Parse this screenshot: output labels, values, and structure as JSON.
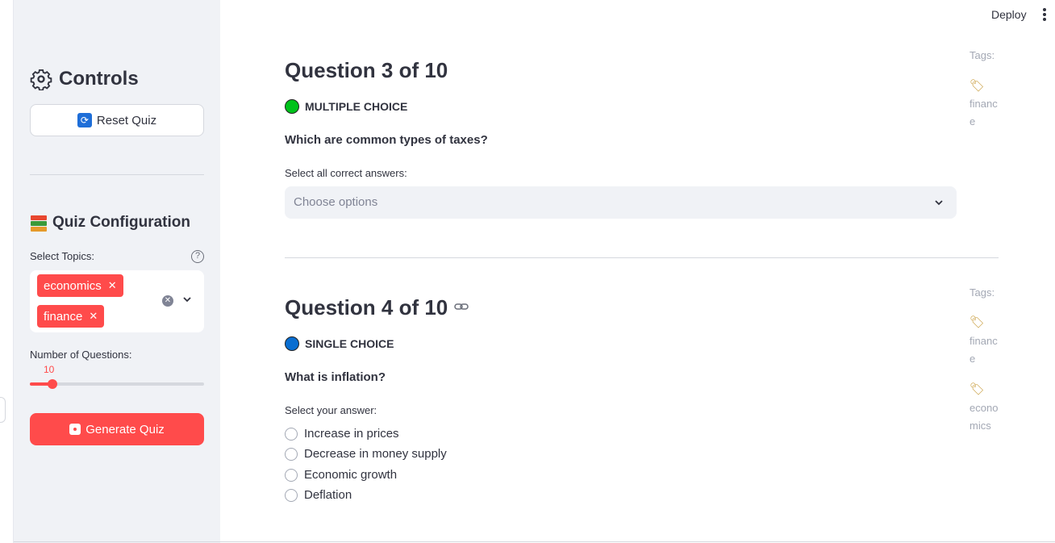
{
  "sidebar": {
    "title": "Controls",
    "reset_button": "Reset Quiz",
    "config_title": "Quiz Configuration",
    "topics_label": "Select Topics:",
    "help_symbol": "?",
    "topics_selected": [
      "economics",
      "finance"
    ],
    "num_questions_label": "Number of Questions:",
    "num_questions_value": "10",
    "num_questions_min": 5,
    "num_questions_max": 50,
    "generate_button": "Generate Quiz"
  },
  "header": {
    "deploy_label": "Deploy"
  },
  "questions": [
    {
      "title": "Question 3 of 10",
      "type_label": "MULTIPLE CHOICE",
      "type_color": "#00c21b",
      "text": "Which are common types of taxes?",
      "instruction": "Select all correct answers:",
      "placeholder": "Choose options",
      "tags_label": "Tags:",
      "tags": [
        "finance"
      ]
    },
    {
      "title": "Question 4 of 10",
      "type_label": "SINGLE CHOICE",
      "type_color": "#0a6ed1",
      "text": "What is inflation?",
      "instruction": "Select your answer:",
      "options": [
        "Increase in prices",
        "Decrease in money supply",
        "Economic growth",
        "Deflation"
      ],
      "tags_label": "Tags:",
      "tags": [
        "finance",
        "economics"
      ]
    }
  ],
  "icons": {
    "gear": "gear-icon",
    "reset": "refresh-icon",
    "books": "books-icon",
    "die": "die-icon",
    "tag": "tag-icon",
    "link": "link-icon"
  },
  "colors": {
    "accent": "#ff4b4b",
    "sidebar_bg": "#f0f2f6"
  }
}
